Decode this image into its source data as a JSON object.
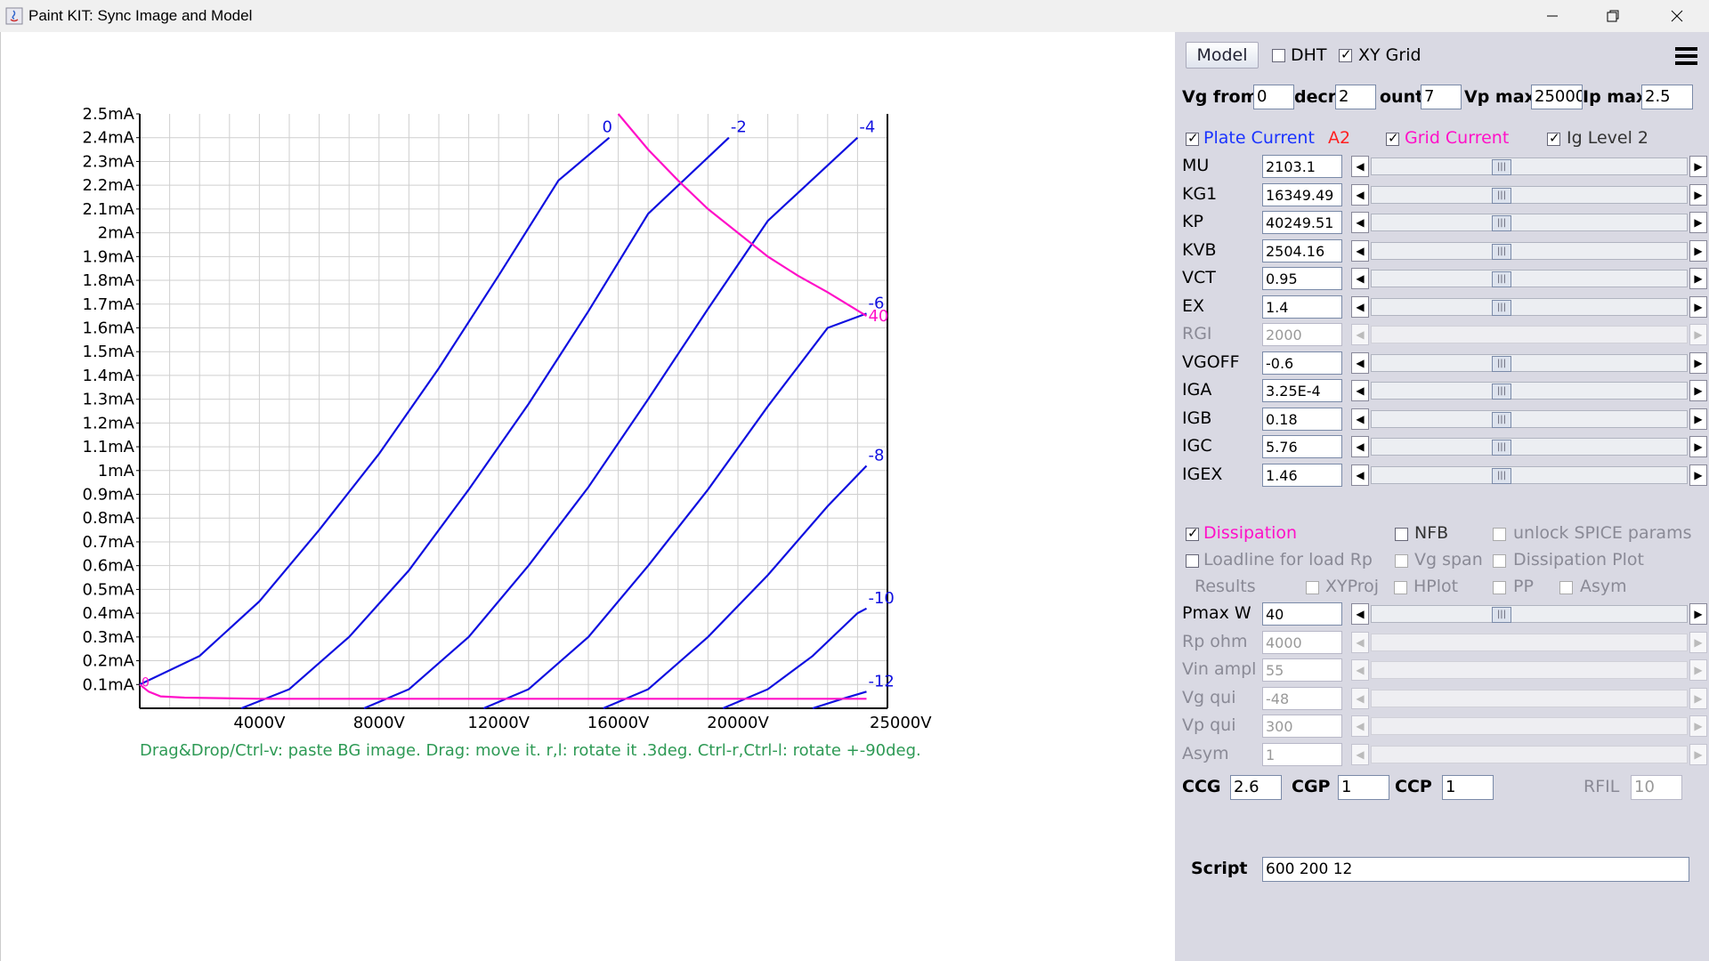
{
  "window": {
    "title": "Paint KIT: Sync Image and Model",
    "minimize_icon": "minimize-icon",
    "restore_icon": "restore-icon",
    "close_icon": "close-icon"
  },
  "chart_data": {
    "type": "line",
    "x_range": [
      0,
      25000
    ],
    "y_range": [
      0,
      2.5
    ],
    "x_ticks": [
      "4000V",
      "8000V",
      "12000V",
      "16000V",
      "20000V",
      "25000V"
    ],
    "x_tick_values": [
      4000,
      8000,
      12000,
      16000,
      20000,
      25000
    ],
    "y_ticks": [
      "0.1mA",
      "0.2mA",
      "0.3mA",
      "0.4mA",
      "0.5mA",
      "0.6mA",
      "0.7mA",
      "0.8mA",
      "0.9mA",
      "1mA",
      "1.1mA",
      "1.2mA",
      "1.3mA",
      "1.4mA",
      "1.5mA",
      "1.6mA",
      "1.7mA",
      "1.8mA",
      "1.9mA",
      "2mA",
      "2.1mA",
      "2.2mA",
      "2.3mA",
      "2.4mA",
      "2.5mA"
    ],
    "grid": true,
    "plate_curves": [
      {
        "label": "0",
        "points": [
          [
            0,
            0.1
          ],
          [
            2000,
            0.22
          ],
          [
            4000,
            0.45
          ],
          [
            6000,
            0.75
          ],
          [
            8000,
            1.07
          ],
          [
            10000,
            1.43
          ],
          [
            12000,
            1.82
          ],
          [
            14000,
            2.22
          ],
          [
            15700,
            2.4
          ]
        ]
      },
      {
        "label": "-2",
        "points": [
          [
            3400,
            0
          ],
          [
            5000,
            0.08
          ],
          [
            7000,
            0.3
          ],
          [
            9000,
            0.58
          ],
          [
            11000,
            0.92
          ],
          [
            13000,
            1.28
          ],
          [
            15000,
            1.67
          ],
          [
            17000,
            2.08
          ],
          [
            19700,
            2.4
          ]
        ]
      },
      {
        "label": "-4",
        "points": [
          [
            7500,
            0
          ],
          [
            9000,
            0.08
          ],
          [
            11000,
            0.3
          ],
          [
            13000,
            0.6
          ],
          [
            15000,
            0.93
          ],
          [
            17000,
            1.3
          ],
          [
            19000,
            1.68
          ],
          [
            21000,
            2.05
          ],
          [
            24000,
            2.4
          ]
        ]
      },
      {
        "label": "-6",
        "points": [
          [
            11500,
            0
          ],
          [
            13000,
            0.08
          ],
          [
            15000,
            0.3
          ],
          [
            17000,
            0.6
          ],
          [
            19000,
            0.92
          ],
          [
            21000,
            1.27
          ],
          [
            23000,
            1.6
          ],
          [
            24300,
            1.66
          ]
        ]
      },
      {
        "label": "-8",
        "points": [
          [
            15500,
            0
          ],
          [
            17000,
            0.08
          ],
          [
            19000,
            0.3
          ],
          [
            21000,
            0.56
          ],
          [
            23000,
            0.85
          ],
          [
            24300,
            1.02
          ]
        ]
      },
      {
        "label": "-10",
        "points": [
          [
            19500,
            0
          ],
          [
            21000,
            0.08
          ],
          [
            22500,
            0.22
          ],
          [
            24000,
            0.4
          ],
          [
            24300,
            0.42
          ]
        ]
      },
      {
        "label": "-12",
        "points": [
          [
            22500,
            0
          ],
          [
            23500,
            0.04
          ],
          [
            24300,
            0.07
          ]
        ]
      }
    ],
    "dissipation_curve": {
      "label": "40",
      "points": [
        [
          16000,
          2.5
        ],
        [
          17000,
          2.35
        ],
        [
          18000,
          2.22
        ],
        [
          19000,
          2.1
        ],
        [
          20000,
          2.0
        ],
        [
          21000,
          1.9
        ],
        [
          22000,
          1.82
        ],
        [
          23000,
          1.75
        ],
        [
          24300,
          1.65
        ]
      ]
    },
    "grid_current_curve": {
      "label": "0",
      "points": [
        [
          0,
          0.1
        ],
        [
          300,
          0.07
        ],
        [
          700,
          0.05
        ],
        [
          1500,
          0.045
        ],
        [
          4000,
          0.04
        ],
        [
          8000,
          0.04
        ],
        [
          12000,
          0.04
        ],
        [
          16000,
          0.04
        ],
        [
          20000,
          0.04
        ],
        [
          24300,
          0.04
        ]
      ]
    },
    "colors": {
      "plate": "#1010e0",
      "grid_current": "#ff10c8",
      "dissipation": "#ff10c8"
    },
    "hint": "Drag&Drop/Ctrl-v: paste BG image. Drag: move it. r,l: rotate it .3deg. Ctrl-r,Ctrl-l: rotate +-90deg."
  },
  "panel": {
    "model_button": "Model",
    "dht": {
      "label": "DHT",
      "checked": false
    },
    "xygrid": {
      "label": "XY Grid",
      "checked": true
    },
    "menu_icon": "hamburger-menu-icon",
    "vg_from": {
      "label": "Vg from",
      "value": "0"
    },
    "decr": {
      "label": "decr",
      "value": "2"
    },
    "count": {
      "label": "ount",
      "value": "7"
    },
    "vp_max": {
      "label": "Vp max",
      "value": "25000"
    },
    "ip_max": {
      "label": "Ip max",
      "value": "2.5"
    },
    "plate_current": {
      "label": "Plate Current",
      "checked": true,
      "extra": "A2"
    },
    "grid_current": {
      "label": "Grid Current",
      "checked": true
    },
    "ig_level2": {
      "label": "Ig Level 2",
      "checked": true
    },
    "params": [
      {
        "name": "MU",
        "value": "2103.1",
        "enabled": true
      },
      {
        "name": "KG1",
        "value": "16349.49",
        "enabled": true
      },
      {
        "name": "KP",
        "value": "40249.51",
        "enabled": true
      },
      {
        "name": "KVB",
        "value": "2504.16",
        "enabled": true
      },
      {
        "name": "VCT",
        "value": "0.95",
        "enabled": true
      },
      {
        "name": "EX",
        "value": "1.4",
        "enabled": true
      },
      {
        "name": "RGI",
        "value": "2000",
        "enabled": false
      },
      {
        "name": "VGOFF",
        "value": "-0.6",
        "enabled": true
      },
      {
        "name": "IGA",
        "value": "3.25E-4",
        "enabled": true
      },
      {
        "name": "IGB",
        "value": "0.18",
        "enabled": true
      },
      {
        "name": "IGC",
        "value": "5.76",
        "enabled": true
      },
      {
        "name": "IGEX",
        "value": "1.46",
        "enabled": true
      }
    ],
    "dissipation": {
      "label": "Dissipation",
      "checked": true
    },
    "nfb": {
      "label": "NFB",
      "checked": false
    },
    "unlock_spice": {
      "label": "unlock SPICE params",
      "checked": false
    },
    "loadline": {
      "label": "Loadline for load Rp",
      "checked": false
    },
    "vg_span": {
      "label": "Vg span",
      "checked": false
    },
    "dissipation_plot": {
      "label": "Dissipation Plot",
      "checked": false
    },
    "results": {
      "label": "Results"
    },
    "xyproj": {
      "label": "XYProj",
      "checked": false
    },
    "hplot": {
      "label": "HPlot",
      "checked": false
    },
    "pp": {
      "label": "PP",
      "checked": false
    },
    "asym_chk": {
      "label": "Asym",
      "checked": false
    },
    "load_params": [
      {
        "name": "Pmax W",
        "value": "40",
        "enabled": true
      },
      {
        "name": "Rp ohm",
        "value": "4000",
        "enabled": false
      },
      {
        "name": "Vin ampl",
        "value": "55",
        "enabled": false
      },
      {
        "name": "Vg qui",
        "value": "-48",
        "enabled": false
      },
      {
        "name": "Vp qui",
        "value": "300",
        "enabled": false
      },
      {
        "name": "Asym",
        "value": "1",
        "enabled": false
      }
    ],
    "ccg": {
      "label": "CCG",
      "value": "2.6"
    },
    "cgp": {
      "label": "CGP",
      "value": "1"
    },
    "ccp": {
      "label": "CCP",
      "value": "1"
    },
    "rfil": {
      "label": "RFIL",
      "value": "10"
    },
    "script": {
      "label": "Script",
      "value": "600 200 12"
    }
  }
}
